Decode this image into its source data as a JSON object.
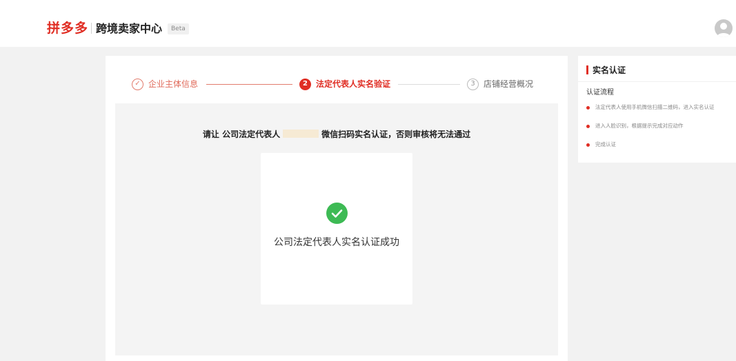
{
  "header": {
    "logo": "拼多多",
    "app_name": "跨境卖家中心",
    "beta": "Beta"
  },
  "steps": [
    {
      "number": "✓",
      "label": "企业主体信息"
    },
    {
      "number": "2",
      "label": "法定代表人实名验证"
    },
    {
      "number": "3",
      "label": "店铺经营概况"
    }
  ],
  "main": {
    "instruction_before": "请让 公司法定代表人",
    "instruction_after": "微信扫码实名认证，否则审核将无法通过",
    "success_text": "公司法定代表人实名认证成功"
  },
  "side": {
    "title": "实名认证",
    "subtitle": "认证流程",
    "items": [
      "法定代表人使用手机微信扫描二维码，进入实名认证",
      "进入人脸识别，根据提示完成对应动作",
      "完成认证"
    ]
  },
  "colors": {
    "brand": "#e02e24",
    "success": "#3dba54"
  },
  "icons": {
    "step1": "check-circle-icon",
    "success": "check-icon",
    "avatar": "user-icon"
  }
}
